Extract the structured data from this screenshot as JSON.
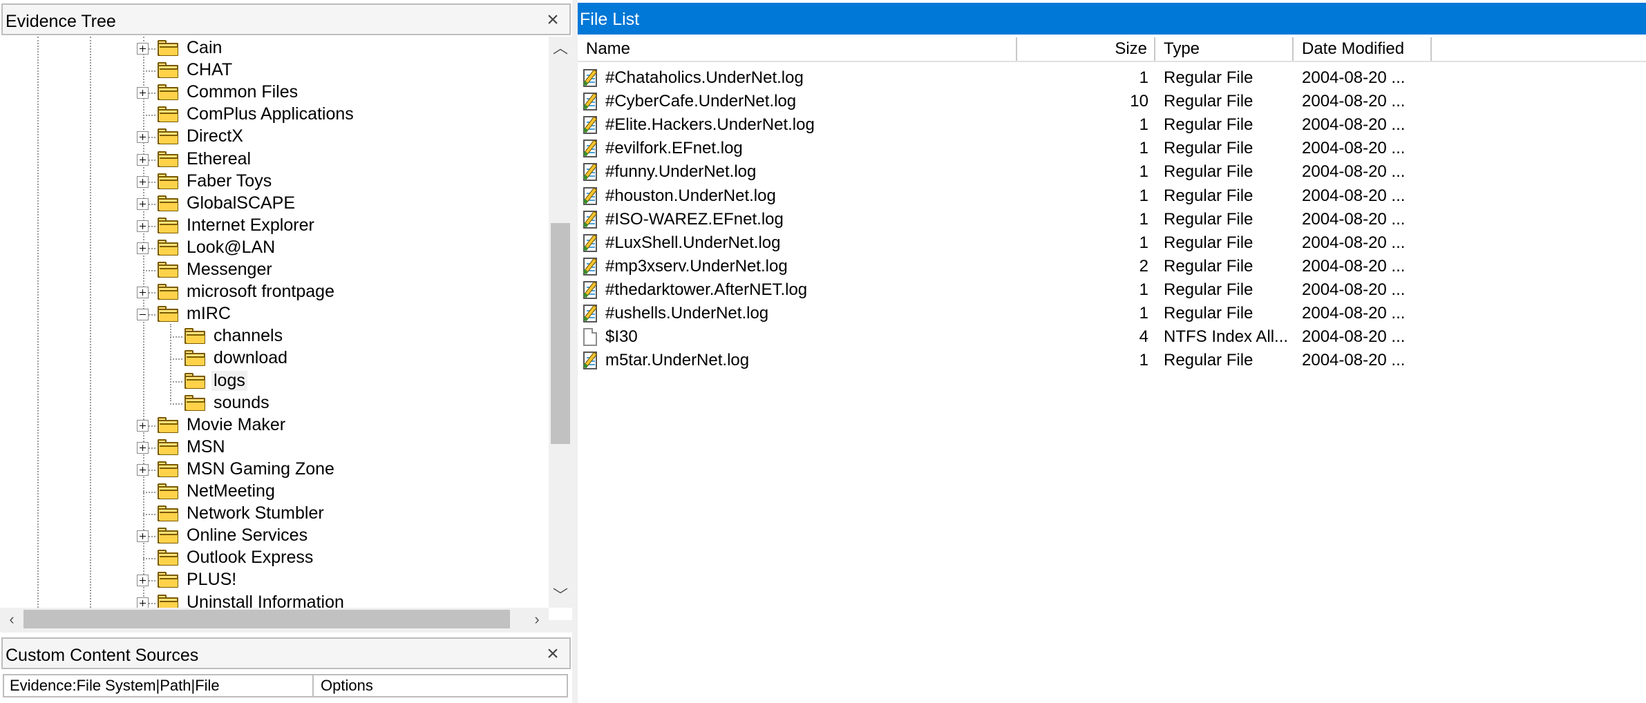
{
  "evidence_tree": {
    "title": "Evidence Tree",
    "close_glyph": "×",
    "items": [
      {
        "label": "Cain",
        "expandable": true
      },
      {
        "label": "CHAT",
        "expandable": false
      },
      {
        "label": "Common Files",
        "expandable": true
      },
      {
        "label": "ComPlus Applications",
        "expandable": false
      },
      {
        "label": "DirectX",
        "expandable": true
      },
      {
        "label": "Ethereal",
        "expandable": true
      },
      {
        "label": "Faber Toys",
        "expandable": true
      },
      {
        "label": "GlobalSCAPE",
        "expandable": true
      },
      {
        "label": "Internet Explorer",
        "expandable": true
      },
      {
        "label": "Look@LAN",
        "expandable": true
      },
      {
        "label": "Messenger",
        "expandable": false
      },
      {
        "label": "microsoft frontpage",
        "expandable": true
      },
      {
        "label": "mIRC",
        "expandable": true,
        "expanded": true
      },
      {
        "label": "channels",
        "expandable": false,
        "child": true
      },
      {
        "label": "download",
        "expandable": false,
        "child": true
      },
      {
        "label": "logs",
        "expandable": false,
        "child": true,
        "selected": true
      },
      {
        "label": "sounds",
        "expandable": false,
        "child": true
      },
      {
        "label": "Movie Maker",
        "expandable": true
      },
      {
        "label": "MSN",
        "expandable": true
      },
      {
        "label": "MSN Gaming Zone",
        "expandable": true
      },
      {
        "label": "NetMeeting",
        "expandable": false
      },
      {
        "label": "Network Stumbler",
        "expandable": false
      },
      {
        "label": "Online Services",
        "expandable": true
      },
      {
        "label": "Outlook Express",
        "expandable": false
      },
      {
        "label": "PLUS!",
        "expandable": true
      },
      {
        "label": "Uninstall Information",
        "expandable": true
      }
    ]
  },
  "scrollbars": {
    "up": "︿",
    "down": "﹀",
    "left": "‹",
    "right": "›"
  },
  "custom_content_sources": {
    "title": "Custom Content Sources",
    "close_glyph": "×",
    "columns": [
      "Evidence:File System|Path|File",
      "Options"
    ]
  },
  "file_list": {
    "title": "File List",
    "columns": {
      "name": "Name",
      "size": "Size",
      "type": "Type",
      "date": "Date Modified"
    },
    "rows": [
      {
        "name": "#Chataholics.UnderNet.log",
        "size": "1",
        "type": "Regular File",
        "date": "2004-08-20 ...",
        "icon": "text-file-icon"
      },
      {
        "name": "#CyberCafe.UnderNet.log",
        "size": "10",
        "type": "Regular File",
        "date": "2004-08-20 ...",
        "icon": "text-file-icon"
      },
      {
        "name": "#Elite.Hackers.UnderNet.log",
        "size": "1",
        "type": "Regular File",
        "date": "2004-08-20 ...",
        "icon": "text-file-icon"
      },
      {
        "name": "#evilfork.EFnet.log",
        "size": "1",
        "type": "Regular File",
        "date": "2004-08-20 ...",
        "icon": "text-file-icon"
      },
      {
        "name": "#funny.UnderNet.log",
        "size": "1",
        "type": "Regular File",
        "date": "2004-08-20 ...",
        "icon": "text-file-icon"
      },
      {
        "name": "#houston.UnderNet.log",
        "size": "1",
        "type": "Regular File",
        "date": "2004-08-20 ...",
        "icon": "text-file-icon"
      },
      {
        "name": "#ISO-WAREZ.EFnet.log",
        "size": "1",
        "type": "Regular File",
        "date": "2004-08-20 ...",
        "icon": "text-file-icon"
      },
      {
        "name": "#LuxShell.UnderNet.log",
        "size": "1",
        "type": "Regular File",
        "date": "2004-08-20 ...",
        "icon": "text-file-icon"
      },
      {
        "name": "#mp3xserv.UnderNet.log",
        "size": "2",
        "type": "Regular File",
        "date": "2004-08-20 ...",
        "icon": "text-file-icon"
      },
      {
        "name": "#thedarktower.AfterNET.log",
        "size": "1",
        "type": "Regular File",
        "date": "2004-08-20 ...",
        "icon": "text-file-icon"
      },
      {
        "name": "#ushells.UnderNet.log",
        "size": "1",
        "type": "Regular File",
        "date": "2004-08-20 ...",
        "icon": "text-file-icon"
      },
      {
        "name": "$I30",
        "size": "4",
        "type": "NTFS Index All...",
        "date": "2004-08-20 ...",
        "icon": "blank-file-icon"
      },
      {
        "name": "m5tar.UnderNet.log",
        "size": "1",
        "type": "Regular File",
        "date": "2004-08-20 ...",
        "icon": "text-file-icon"
      }
    ]
  },
  "colors": {
    "title_bar_blue": "#0078d7",
    "folder_yellow": "#ffe27a"
  }
}
